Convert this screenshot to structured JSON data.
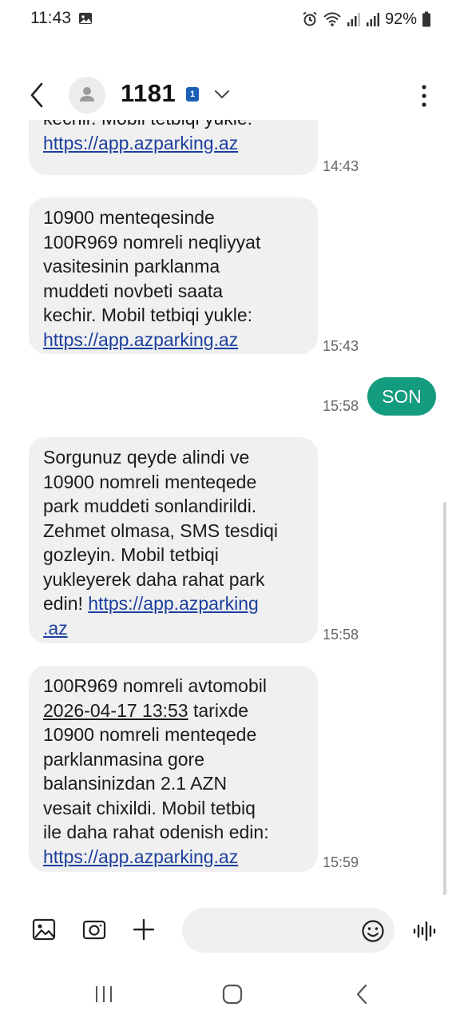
{
  "status_bar": {
    "time": "11:43",
    "battery": "92%",
    "icons": [
      "photo-icon",
      "alarm-icon",
      "wifi-icon",
      "signal-icon",
      "signal-icon",
      "battery-icon"
    ]
  },
  "header": {
    "contact_name": "1181",
    "sim_badge": "1"
  },
  "messages": [
    {
      "direction": "received",
      "partial": true,
      "text": "kechir. Mobil tetbiqi yukle:",
      "link": "https://app.azparking.az",
      "time": "14:43"
    },
    {
      "direction": "received",
      "lines": [
        "10900 menteqesinde",
        "100R969 nomreli neqliyyat",
        "vasitesinin parklanma",
        "muddeti novbeti saata",
        "kechir. Mobil tetbiqi yukle:"
      ],
      "link": "https://app.azparking.az",
      "time": "15:43"
    },
    {
      "direction": "sent",
      "text": "SON",
      "time": "15:58"
    },
    {
      "direction": "received",
      "lines": [
        "Sorgunuz qeyde alindi ve",
        "10900 nomreli menteqede",
        "park muddeti sonlandirildi.",
        "Zehmet olmasa, SMS tesdiqi",
        "gozleyin. Mobil tetbiqi",
        "yukleyerek daha rahat park"
      ],
      "last_line_prefix": "edin! ",
      "link_part1": "https://app.azparking",
      "link_part2": ".az",
      "time": "15:58"
    },
    {
      "direction": "received",
      "line1": "100R969 nomreli avtomobil",
      "date_link": "2026-04-17 13:53",
      "date_suffix": " tarixde",
      "lines": [
        "10900 nomreli menteqede",
        "parklanmasina gore",
        "balansinizdan 2.1 AZN",
        "vesait chixildi. Mobil tetbiq",
        "ile daha rahat odenish edin:"
      ],
      "link": "https://app.azparking.az",
      "time": "15:59"
    }
  ],
  "composer": {
    "icons": [
      "gallery-icon",
      "camera-icon",
      "plus-icon",
      "emoji-icon",
      "voice-icon"
    ]
  },
  "colors": {
    "sent_bubble": "#149c7f",
    "received_bubble": "#f0f0f0",
    "link": "#1c3f9e",
    "sim_badge": "#1a5fb4"
  }
}
